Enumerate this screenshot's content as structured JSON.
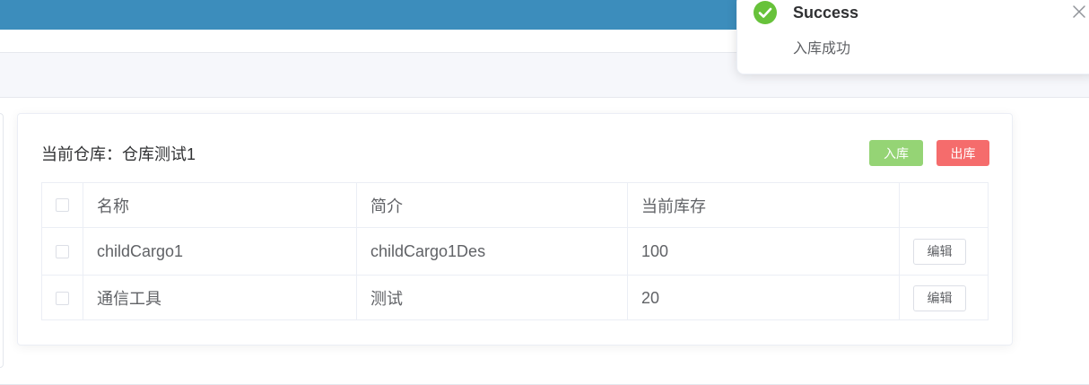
{
  "colors": {
    "topbar": "#3c8dbc",
    "success": "#67c23a",
    "btn_in": "#95d475",
    "btn_out": "#f56c6c"
  },
  "toast": {
    "type": "success",
    "icon": "check-circle-icon",
    "title": "Success",
    "message": "入库成功",
    "close_icon": "close-icon"
  },
  "warehouse": {
    "title": "当前仓库：仓库测试1",
    "buttons": {
      "in_label": "入库",
      "out_label": "出库"
    }
  },
  "table": {
    "columns": [
      "名称",
      "简介",
      "当前库存",
      ""
    ],
    "rows": [
      {
        "name": "childCargo1",
        "desc": "childCargo1Des",
        "stock": "100",
        "action": "编辑"
      },
      {
        "name": "通信工具",
        "desc": "测试",
        "stock": "20",
        "action": "编辑"
      }
    ]
  }
}
